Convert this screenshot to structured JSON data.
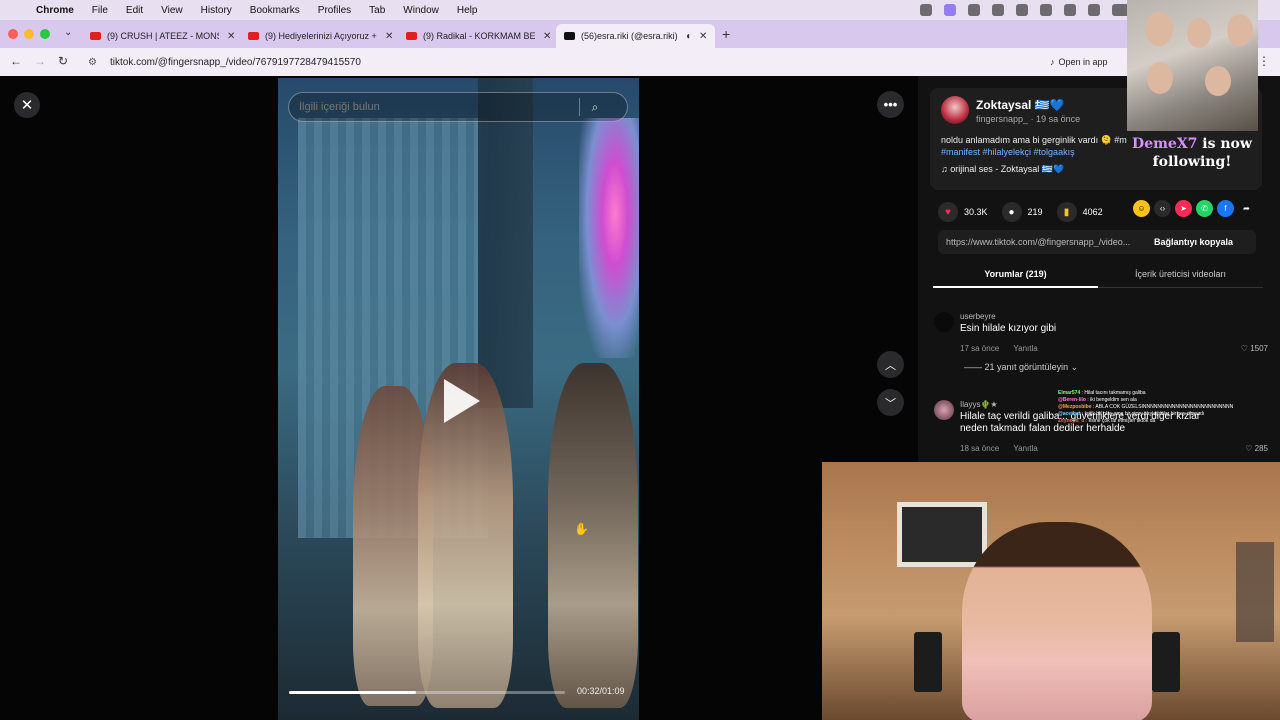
{
  "menubar": {
    "app": "Chrome",
    "items": [
      "File",
      "Edit",
      "View",
      "History",
      "Bookmarks",
      "Profiles",
      "Tab",
      "Window",
      "Help"
    ]
  },
  "tabs": [
    {
      "title": "(9) CRUSH | ATEEZ - MONST",
      "favicon": "youtube-icon"
    },
    {
      "title": "(9) Hediyelerinizi Açıyoruz +",
      "favicon": "youtube-icon"
    },
    {
      "title": "(9) Radikal - KORKMAM BEN",
      "favicon": "youtube-icon"
    },
    {
      "title": "(56)esra.riki (@esra.riki) |",
      "favicon": "tiktok-icon"
    }
  ],
  "address": {
    "url": "tiktok.com/@fingersnapp_/video/7679197728479415570",
    "open_in_app": "Open in app"
  },
  "video": {
    "search_placeholder": "İlgili içeriği bulun",
    "time": "00:32/01:09",
    "progress": 0.46
  },
  "post": {
    "display_name": "Zoktaysal 🇬🇷💙",
    "username": "fingersnapp_",
    "ago": "· 19 sa önce",
    "description": "noldu anlamadım ama bi gerginlik vardı 🫠 #m",
    "hashtags_line1": "#manifest #hilalyelekçi #tolgaakış",
    "music": "orijinal ses - Zoktaysal 🇬🇷💙",
    "likes": "30.3K",
    "comments": "219",
    "saves": "4062",
    "link": "https://www.tiktok.com/@fingersnapp_/video...",
    "copy_label": "Bağlantıyı kopyala"
  },
  "panel_tabs": {
    "comments": "Yorumlar (219)",
    "creator_videos": "İçerik üreticisi videoları"
  },
  "comments": [
    {
      "user": "userbeyre",
      "text": "Esin hilale kızıyor gibi",
      "time": "17 sa önce",
      "reply": "Yanıtla",
      "likes": "1507"
    },
    {
      "user": "Ilayys🌵★",
      "text": "Hilale taç verildi galiba... güvenliklere verdi diğer kızlar neden takmadı falan dediler herhalde",
      "time": "18 sa önce",
      "reply": "Yanıtla",
      "likes": "285"
    }
  ],
  "view_replies": "21 yanıt görüntüleyin",
  "stream": {
    "follow_name": "DemeX7",
    "follow_text": "is now following!",
    "chat": [
      {
        "user": "Elmar574",
        "msg": "Hilal tacını takmamış galiba"
      },
      {
        "user": "@Beren-lilo",
        "msg": "iki bengeldim sen ala"
      },
      {
        "user": "@Mezposbibe",
        "msg": "ABLA COK GÜZELSINNNNNNNNNNNNNNNNNNNNNNNNN"
      },
      {
        "user": "@acethat",
        "msg": "kritik bir olay ama bir story paylaşsalar bir şey olmazdı"
      },
      {
        "user": "Zeynepd_d",
        "msg": "esine çok laf etmişler tiktok da"
      }
    ]
  }
}
